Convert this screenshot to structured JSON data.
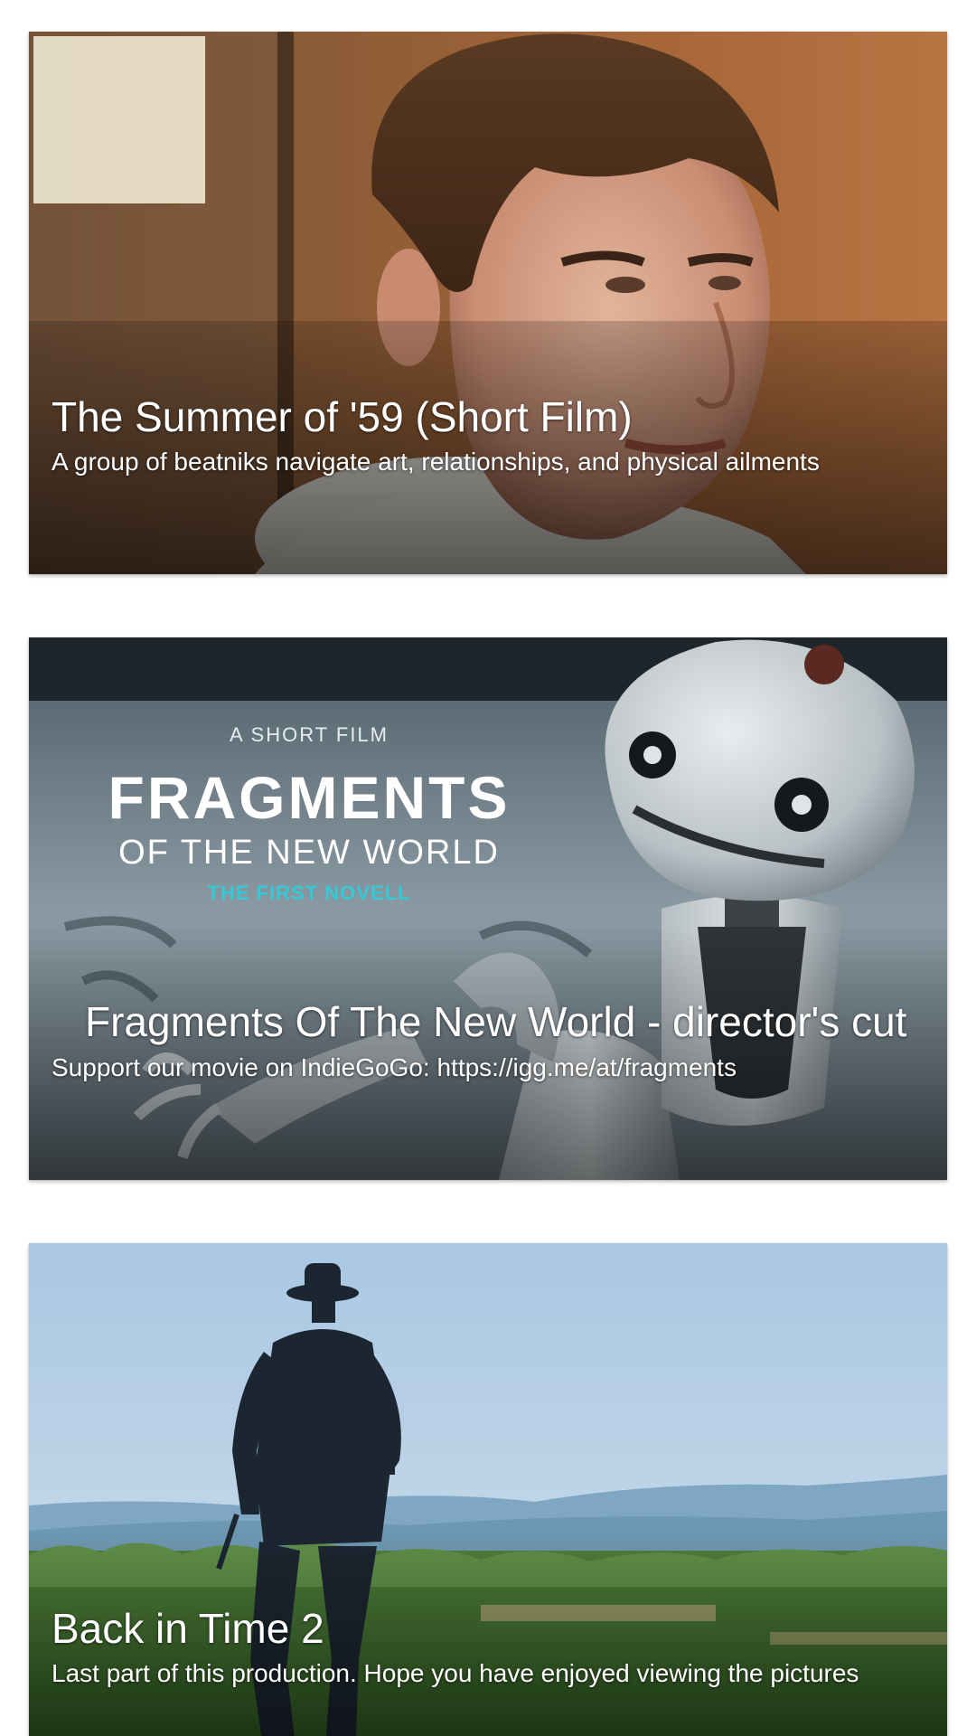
{
  "videos": [
    {
      "title": "The Summer of '59 (Short Film)",
      "description": "A group of beatniks navigate art, relationships, and physical ailments"
    },
    {
      "title": "Fragments Of The New World - director's cut",
      "description": "Support our movie on IndieGoGo: https://igg.me/at/fragments",
      "poster": {
        "kicker": "A SHORT FILM",
        "title_line1": "FRAGMENTS",
        "title_line2": "OF THE NEW WORLD",
        "subtitle": "THE FIRST NOVELL"
      }
    },
    {
      "title": "Back in Time 2",
      "description": "Last part of this production. Hope you have enjoyed viewing the pictures"
    }
  ],
  "colors": {
    "poster_accent": "#35c9d6",
    "card_text": "#ffffff"
  }
}
